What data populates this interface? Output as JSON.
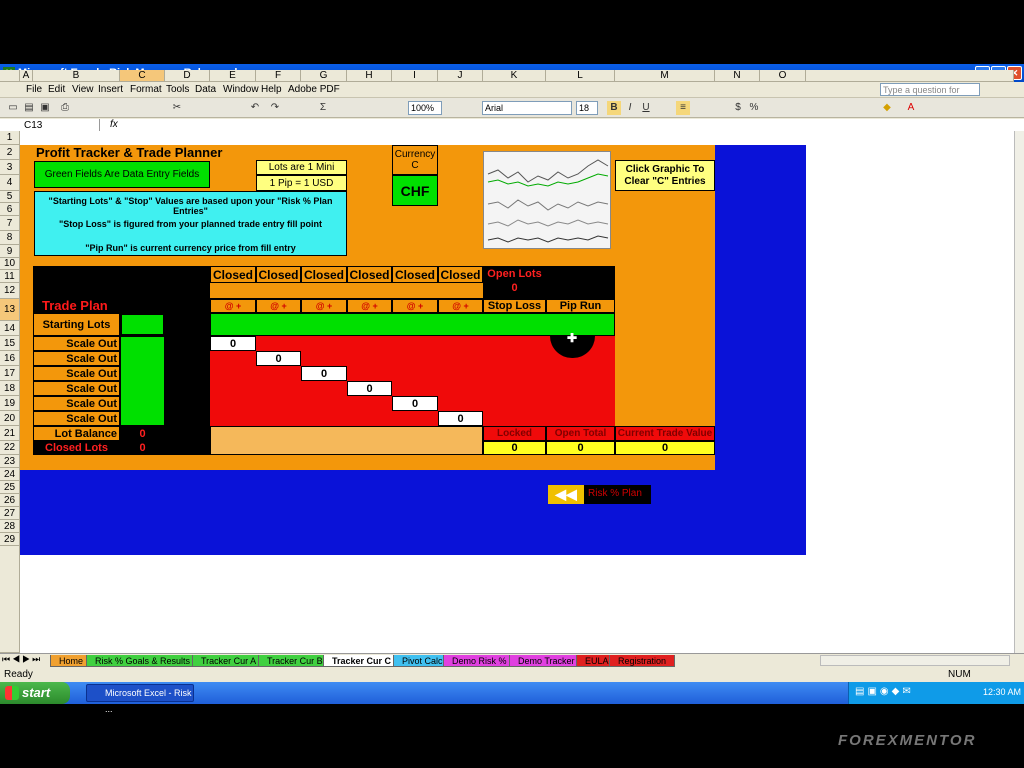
{
  "window": {
    "title": "Microsoft Excel - Risk Manager Release.xls"
  },
  "menu": [
    "File",
    "Edit",
    "View",
    "Insert",
    "Format",
    "Tools",
    "Data",
    "Window",
    "Help",
    "Adobe PDF"
  ],
  "toolbar": {
    "zoom": "100%",
    "font": "Arial",
    "size": "18",
    "help_placeholder": "Type a question for help"
  },
  "namebox": "C13",
  "columns": [
    "A",
    "B",
    "C",
    "D",
    "E",
    "F",
    "G",
    "H",
    "I",
    "J",
    "K",
    "L",
    "M",
    "N",
    "O"
  ],
  "rows": [
    "1",
    "2",
    "3",
    "4",
    "5",
    "6",
    "7",
    "8",
    "9",
    "10",
    "11",
    "12",
    "13",
    "14",
    "15",
    "16",
    "17",
    "18",
    "19",
    "20",
    "21",
    "22",
    "23",
    "24",
    "25",
    "26",
    "27",
    "28",
    "29"
  ],
  "sheet": {
    "title": "Profit Tracker & Trade Planner",
    "green_note": "Green Fields Are Data Entry Fields",
    "lots_mini": "Lots are 1 Mini",
    "pip_usd": "1 Pip = 1 USD",
    "currency_label": "Currency C",
    "currency": "CHF",
    "chart_button": "Click Graphic To Clear \"C\" Entries",
    "note1": "\"Starting Lots\" & \"Stop\" Values are based upon your \"Risk % Plan Entries\"",
    "note2": "\"Stop Loss\" is figured from your planned trade entry fill point",
    "note3": "\"Pip Run\" is current currency price from fill entry",
    "trade_plan": "Trade Plan",
    "closed": [
      "Closed",
      "Closed",
      "Closed",
      "Closed",
      "Closed",
      "Closed"
    ],
    "open_lots": "Open Lots",
    "open_lots_val": "0",
    "at_plus": [
      "@ +",
      "@ +",
      "@ +",
      "@ +",
      "@ +",
      "@ +"
    ],
    "stop_loss": "Stop Loss",
    "pip_run": "Pip Run",
    "starting_lots": "Starting Lots",
    "scale_out": [
      "Scale Out",
      "Scale Out",
      "Scale Out",
      "Scale Out",
      "Scale Out",
      "Scale Out"
    ],
    "diag_zeros": [
      "0",
      "0",
      "0",
      "0",
      "0",
      "0"
    ],
    "lot_balance": "Lot Balance",
    "lot_balance_val": "0",
    "closed_lots": "Closed Lots",
    "closed_lots_val": "0",
    "locked": "Locked",
    "open_total": "Open Total",
    "current_value": "Current Trade Value",
    "locked_val": "0",
    "open_total_val": "0",
    "current_value_val": "0",
    "nav_button": "Risk % Plan"
  },
  "tabs": [
    {
      "label": "Home",
      "color": "#f0a030"
    },
    {
      "label": "Risk % Goals & Results",
      "color": "#40d040"
    },
    {
      "label": "Tracker Cur A",
      "color": "#40d040"
    },
    {
      "label": "Tracker Cur B",
      "color": "#40d040"
    },
    {
      "label": "Tracker Cur C",
      "color": "#ffffff"
    },
    {
      "label": "Pivot Calc",
      "color": "#40c0f0"
    },
    {
      "label": "Demo Risk %",
      "color": "#e040e0"
    },
    {
      "label": "Demo Tracker",
      "color": "#e040e0"
    },
    {
      "label": "EULA",
      "color": "#e02020"
    },
    {
      "label": "Registration",
      "color": "#e02020"
    }
  ],
  "status": {
    "left": "Ready",
    "num": "NUM"
  },
  "taskbar": {
    "start": "start",
    "task": "Microsoft Excel - Risk ...",
    "clock": "12:30 AM"
  },
  "watermark": "FOREXMENTOR"
}
